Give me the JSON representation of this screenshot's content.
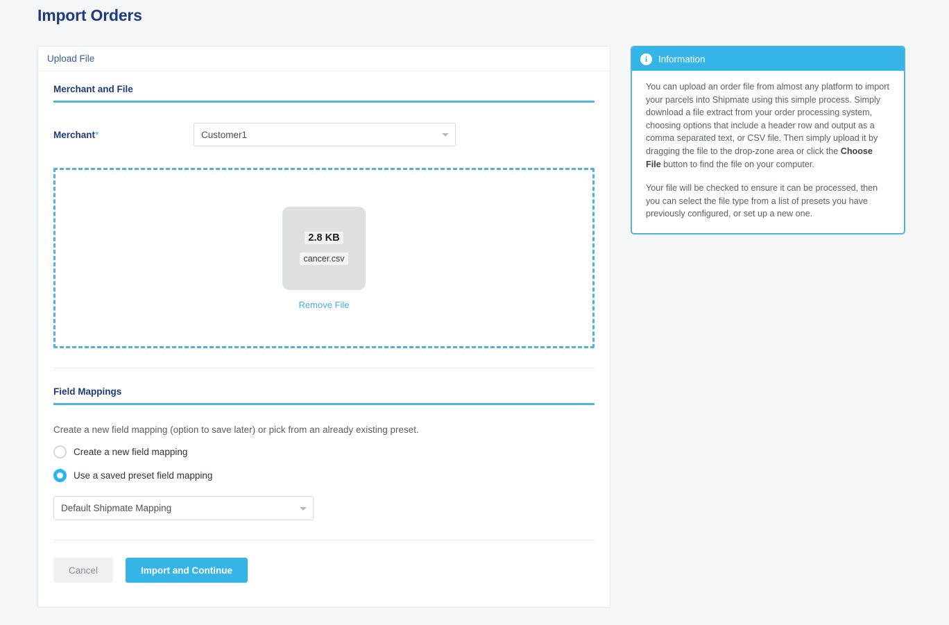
{
  "page": {
    "title": "Import Orders",
    "title_color": "#1f3a7a",
    "accent_color": "#35b4e8",
    "background": "#f4f6f8"
  },
  "upload_card": {
    "header": "Upload File",
    "sections": {
      "merchant_and_file": {
        "heading": "Merchant and File",
        "merchant_label": "Merchant",
        "required_marker": "*",
        "merchant_select": {
          "value": "Customer1",
          "caret_icon": "chevron-down-icon",
          "options": [
            "Customer1"
          ]
        },
        "dropzone": {
          "file_size": "2.8 KB",
          "file_name": "cancer.csv",
          "remove_link": "Remove File",
          "border_color": "#4eb3dd"
        }
      },
      "field_mappings": {
        "heading": "Field Mappings",
        "description": "Create a new field mapping (option to save later) or pick from an already existing preset.",
        "radios": [
          {
            "label": "Create a new field mapping",
            "checked": false
          },
          {
            "label": "Use a saved preset field mapping",
            "checked": true
          }
        ],
        "preset_select": {
          "value": "Default Shipmate Mapping",
          "caret_icon": "chevron-down-icon",
          "options": [
            "Default Shipmate Mapping"
          ]
        }
      }
    },
    "footer": {
      "cancel_label": "Cancel",
      "submit_label": "Import and Continue",
      "submit_color": "#35b4e8"
    }
  },
  "info_panel": {
    "icon": "info-circle-icon",
    "title": "Information",
    "paragraph_1_part_1": "You can upload an order file from almost any platform to import your parcels into Shipmate using this simple process. Simply download a file extract from your order processing system, choosing options that include a header row and output as a comma separated text, or CSV file. Then simply upload it by dragging the file to the drop-zone area or click the ",
    "paragraph_1_bold": "Choose File",
    "paragraph_1_part_2": " button to find the file on your computer.",
    "paragraph_2": "Your file will be checked to ensure it can be processed, then you can select the file type from a list of presets you have previously configured, or set up a new one."
  }
}
